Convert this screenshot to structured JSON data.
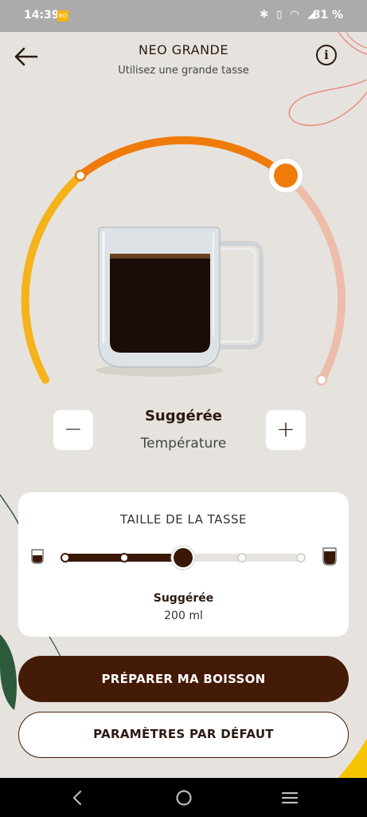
{
  "status_bar": {
    "time": "14:39",
    "icons": "✱ ▯ ◠ ◢",
    "battery": "81 %"
  },
  "header": {
    "title": "NEO GRANDE",
    "subtitle": "Utilisez une grande tasse",
    "back_icon": "arrow-left-icon",
    "info_icon": "i"
  },
  "temperature": {
    "value": "Suggérée",
    "label": "Température",
    "minus": "−",
    "plus": "+",
    "levels": 3,
    "selected_level": 2
  },
  "cup_size": {
    "title": "TAILLE DE LA TASSE",
    "value": "Suggérée",
    "volume": "200 ml",
    "steps": 5,
    "selected_step": 3
  },
  "actions": {
    "prepare": "PRÉPARER MA BOISSON",
    "default": "PARAMÈTRES PAR DÉFAUT"
  },
  "colors": {
    "accent_orange": "#ef7b0a",
    "accent_yellow": "#f6b21b",
    "accent_pink": "#edbdaa",
    "brand_brown": "#441b07",
    "background": "#e6e3df"
  }
}
